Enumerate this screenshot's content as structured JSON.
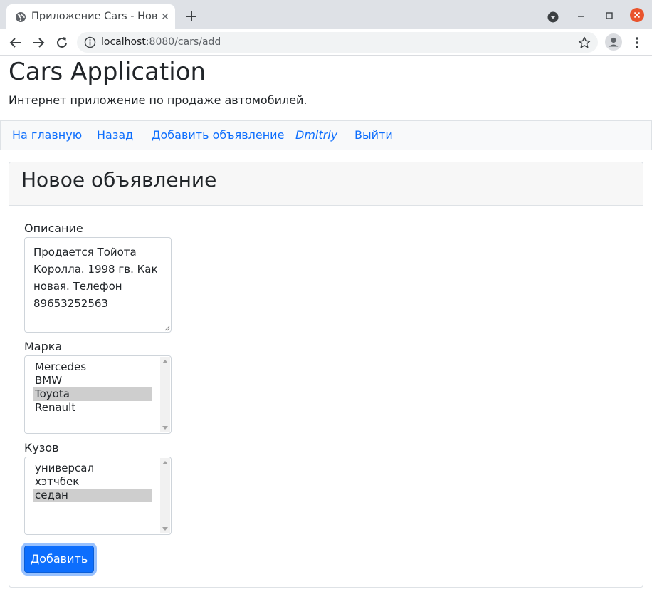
{
  "browser": {
    "tab_title": "Приложение Cars - Новое объявление",
    "url_host": "localhost",
    "url_rest": ":8080/cars/add",
    "icons": [
      "globe-icon",
      "close-icon",
      "plus-icon",
      "back-icon",
      "forward-icon",
      "reload-icon",
      "info-icon",
      "star-icon",
      "profile-icon",
      "menu-icon",
      "minimize-icon",
      "maximize-icon"
    ]
  },
  "header": {
    "brand": "Cars Application",
    "lead": "Интернет приложение по продаже автомобилей."
  },
  "nav": {
    "home": "На главную",
    "back": "Назад",
    "add_ad": "Добавить объявление",
    "user": "Dmitriy",
    "logout": "Выйти"
  },
  "form": {
    "title": "Новое объявление",
    "description_label": "Описание",
    "description_value": "Продается Тойота Королла. 1998 гв. Как новая. Телефон 89653252563",
    "brand_label": "Марка",
    "brand_options": [
      "Mercedes",
      "BMW",
      "Toyota",
      "Renault"
    ],
    "brand_selected": "Toyota",
    "body_label": "Кузов",
    "body_options": [
      "универсал",
      "хэтчбек",
      "седан"
    ],
    "body_selected": "седан",
    "submit_label": "Добавить"
  },
  "colors": {
    "link": "#0d6efd",
    "primary": "#0d6efd",
    "selected_option": "#cecece",
    "window_close": "#e9542d"
  }
}
